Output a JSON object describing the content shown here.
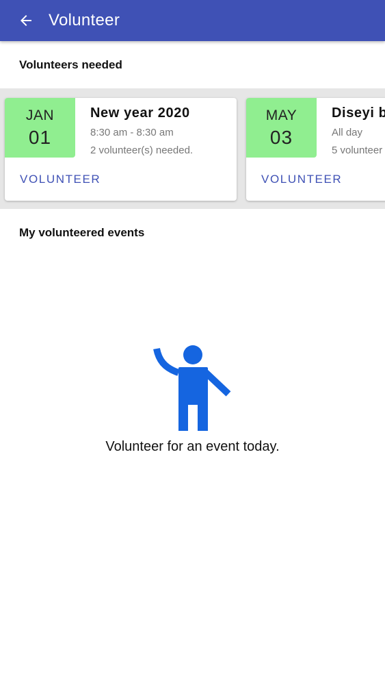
{
  "appbar": {
    "title": "Volunteer",
    "back_icon": "arrow-back-icon",
    "color": "#3f51b5"
  },
  "needed": {
    "heading": "Volunteers needed",
    "cards": [
      {
        "month": "JAN",
        "day": "01",
        "title": "New year 2020",
        "time": "8:30 am - 8:30 am",
        "needed": "2 volunteer(s) needed.",
        "button": "VOLUNTEER"
      },
      {
        "month": "MAY",
        "day": "03",
        "title": "Diseyi b",
        "time": "All day",
        "needed": "5 volunteer",
        "button": "VOLUNTEER"
      }
    ],
    "date_color": "#90ee90"
  },
  "mine": {
    "heading": "My volunteered events",
    "empty_icon": "person-waving-icon",
    "empty_text": "Volunteer for an event today.",
    "icon_color": "#1565e0"
  }
}
